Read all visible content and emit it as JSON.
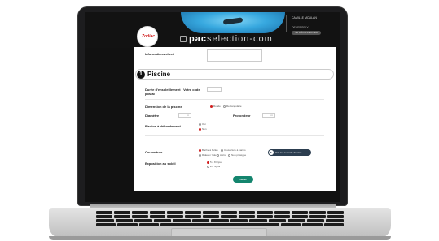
{
  "header": {
    "logo_text": "Zodiac",
    "brand_first": "pac",
    "brand_rest": "selection-com",
    "user_name": "CAMILLE MOULAN",
    "user_role": "DEVERSELY",
    "user_button": "SE DÉCONNECTER"
  },
  "form": {
    "client_info_label": "Informations client",
    "section_number": "1",
    "section_title": "Piscine",
    "fields": {
      "install_label": "Durée d'ensoleillement : Votre code postal",
      "dimension_label": "Dimension de la piscine",
      "dimension_options": [
        "Ronde",
        "Rectangulaire"
      ],
      "dimension_selected": "Ronde",
      "diameter_label": "Diamètre",
      "diameter_unit": "m",
      "depth_label": "Profondeur",
      "depth_unit": "m",
      "overflow_label": "Piscine à débordement",
      "overflow_options": [
        "Oui",
        "Non"
      ],
      "overflow_selected": "Non",
      "cover_label": "Couverture",
      "cover_options": [
        "Bâche à bulles",
        "Couverture à barres",
        "Rideau / Volet",
        "Abris",
        "Non protégée"
      ],
      "cover_selected": "Bâche à bulles",
      "tips_button": "Voir les conseils d'accès",
      "sun_label": "Exposition au soleil",
      "sun_options": [
        "5 à 8 h/jour",
        "≥ 8 h/jour"
      ],
      "sun_selected": "5 à 8 h/jour"
    },
    "submit_label": "Valider"
  },
  "colors": {
    "accent_red": "#d11d1d",
    "submit_green": "#14856e",
    "tips_dark": "#2c3e50"
  }
}
